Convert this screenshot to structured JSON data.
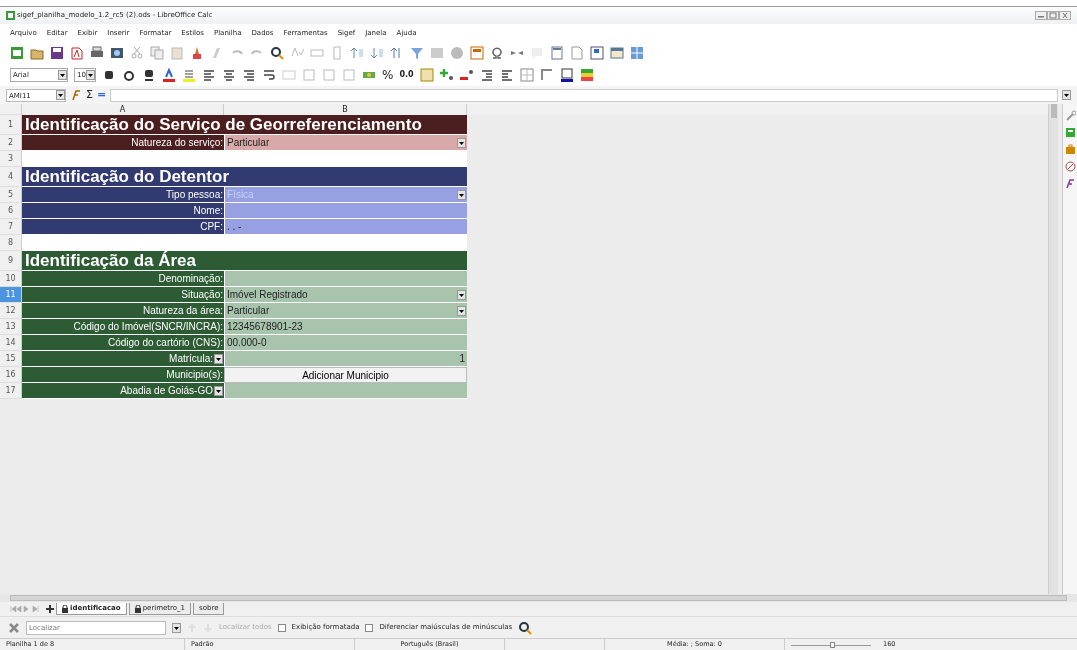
{
  "window": {
    "title": "sigef_planilha_modelo_1.2_rc5 (2).ods - LibreOffice Calc"
  },
  "menu": [
    "Arquivo",
    "Editar",
    "Exibir",
    "Inserir",
    "Formatar",
    "Estilos",
    "Planilha",
    "Dados",
    "Ferramentas",
    "Sigef",
    "Janela",
    "Ajuda"
  ],
  "formatting": {
    "font_name": "Arial",
    "font_size": "10",
    "percent": "%",
    "decimal": "0.0"
  },
  "formula_bar": {
    "name_box": "AMI11",
    "sum": "Σ",
    "equals": "="
  },
  "columns": [
    "A",
    "B"
  ],
  "rows": [
    {
      "row": "1",
      "kind": "section",
      "title": "Identificação do Serviço de Georreferenciamento",
      "color": "#4b1f1f",
      "selected": false
    },
    {
      "row": "2",
      "kind": "field",
      "label": "Natureza do serviço:",
      "value": "Particular",
      "color": "#d9a9a9",
      "dropdown": true,
      "selected": false
    },
    {
      "row": "3",
      "kind": "blank",
      "selected": false
    },
    {
      "row": "4",
      "kind": "section",
      "title": "Identificação do Detentor",
      "color": "#323a72",
      "selected": false
    },
    {
      "row": "5",
      "kind": "field",
      "label": "Tipo pessoa:",
      "value": "Física",
      "color": "#97a0e2",
      "dropdown": true,
      "disabled": true,
      "selected": false
    },
    {
      "row": "6",
      "kind": "field",
      "label": "Nome:",
      "color": "#97a0e2",
      "selected": false
    },
    {
      "row": "7",
      "kind": "field",
      "label": "CPF:",
      "value": ". . -",
      "color": "#97a0e2",
      "selected": false
    },
    {
      "row": "8",
      "kind": "blank",
      "selected": false
    },
    {
      "row": "9",
      "kind": "section",
      "title": "Identificação da Área",
      "color": "#2d5c34",
      "selected": false
    },
    {
      "row": "10",
      "kind": "field",
      "label": "Denominação:",
      "color": "#a9c4ad",
      "selected": false
    },
    {
      "row": "11",
      "kind": "field",
      "label": "Situação:",
      "value": "Imóvel Registrado",
      "color": "#a9c4ad",
      "dropdown": true,
      "selected": true
    },
    {
      "row": "12",
      "kind": "field",
      "label": "Natureza da área:",
      "value": "Particular",
      "color": "#a9c4ad",
      "dropdown": true,
      "selected": false
    },
    {
      "row": "13",
      "kind": "field",
      "label": "Código do Imóvel(SNCR/INCRA):",
      "value": "12345678901-23",
      "color": "#a9c4ad",
      "selected": false
    },
    {
      "row": "14",
      "kind": "field",
      "label": "Código do cartório (CNS):",
      "value": "00.000-0",
      "color": "#a9c4ad",
      "selected": false
    },
    {
      "row": "15",
      "kind": "field",
      "label": "Matrícula:",
      "value": "1",
      "color": "#a9c4ad",
      "label_dropdown": true,
      "align_right": true,
      "selected": false
    },
    {
      "row": "16",
      "kind": "button",
      "label": "Municipio(s):",
      "button": "Adicionar Municipio",
      "selected": false
    },
    {
      "row": "17",
      "kind": "field",
      "label": "Abadia de Goiás-GO",
      "color": "#a9c4ad",
      "label_dropdown": true,
      "selected": false
    }
  ],
  "sheet_tabs": [
    {
      "label": "identificacao",
      "locked": true,
      "selected": true
    },
    {
      "label": "perimetro_1",
      "locked": true,
      "selected": false
    },
    {
      "label": "sobre",
      "locked": false,
      "selected": false
    }
  ],
  "find_bar": {
    "placeholder": "Localizar",
    "find_all": "Localizar todos",
    "find_all_disabled": true,
    "options": [
      {
        "label": "Exibição formatada",
        "checked": false
      },
      {
        "label": "Diferenciar maiúsculas de minúsculas",
        "checked": false
      }
    ]
  },
  "status_bar": [
    "Planilha 1 de 8",
    "Padrão",
    "Português (Brasil)",
    "Média: ; Soma: 0",
    "160"
  ],
  "zoom_slider": {
    "level": 0.52
  }
}
